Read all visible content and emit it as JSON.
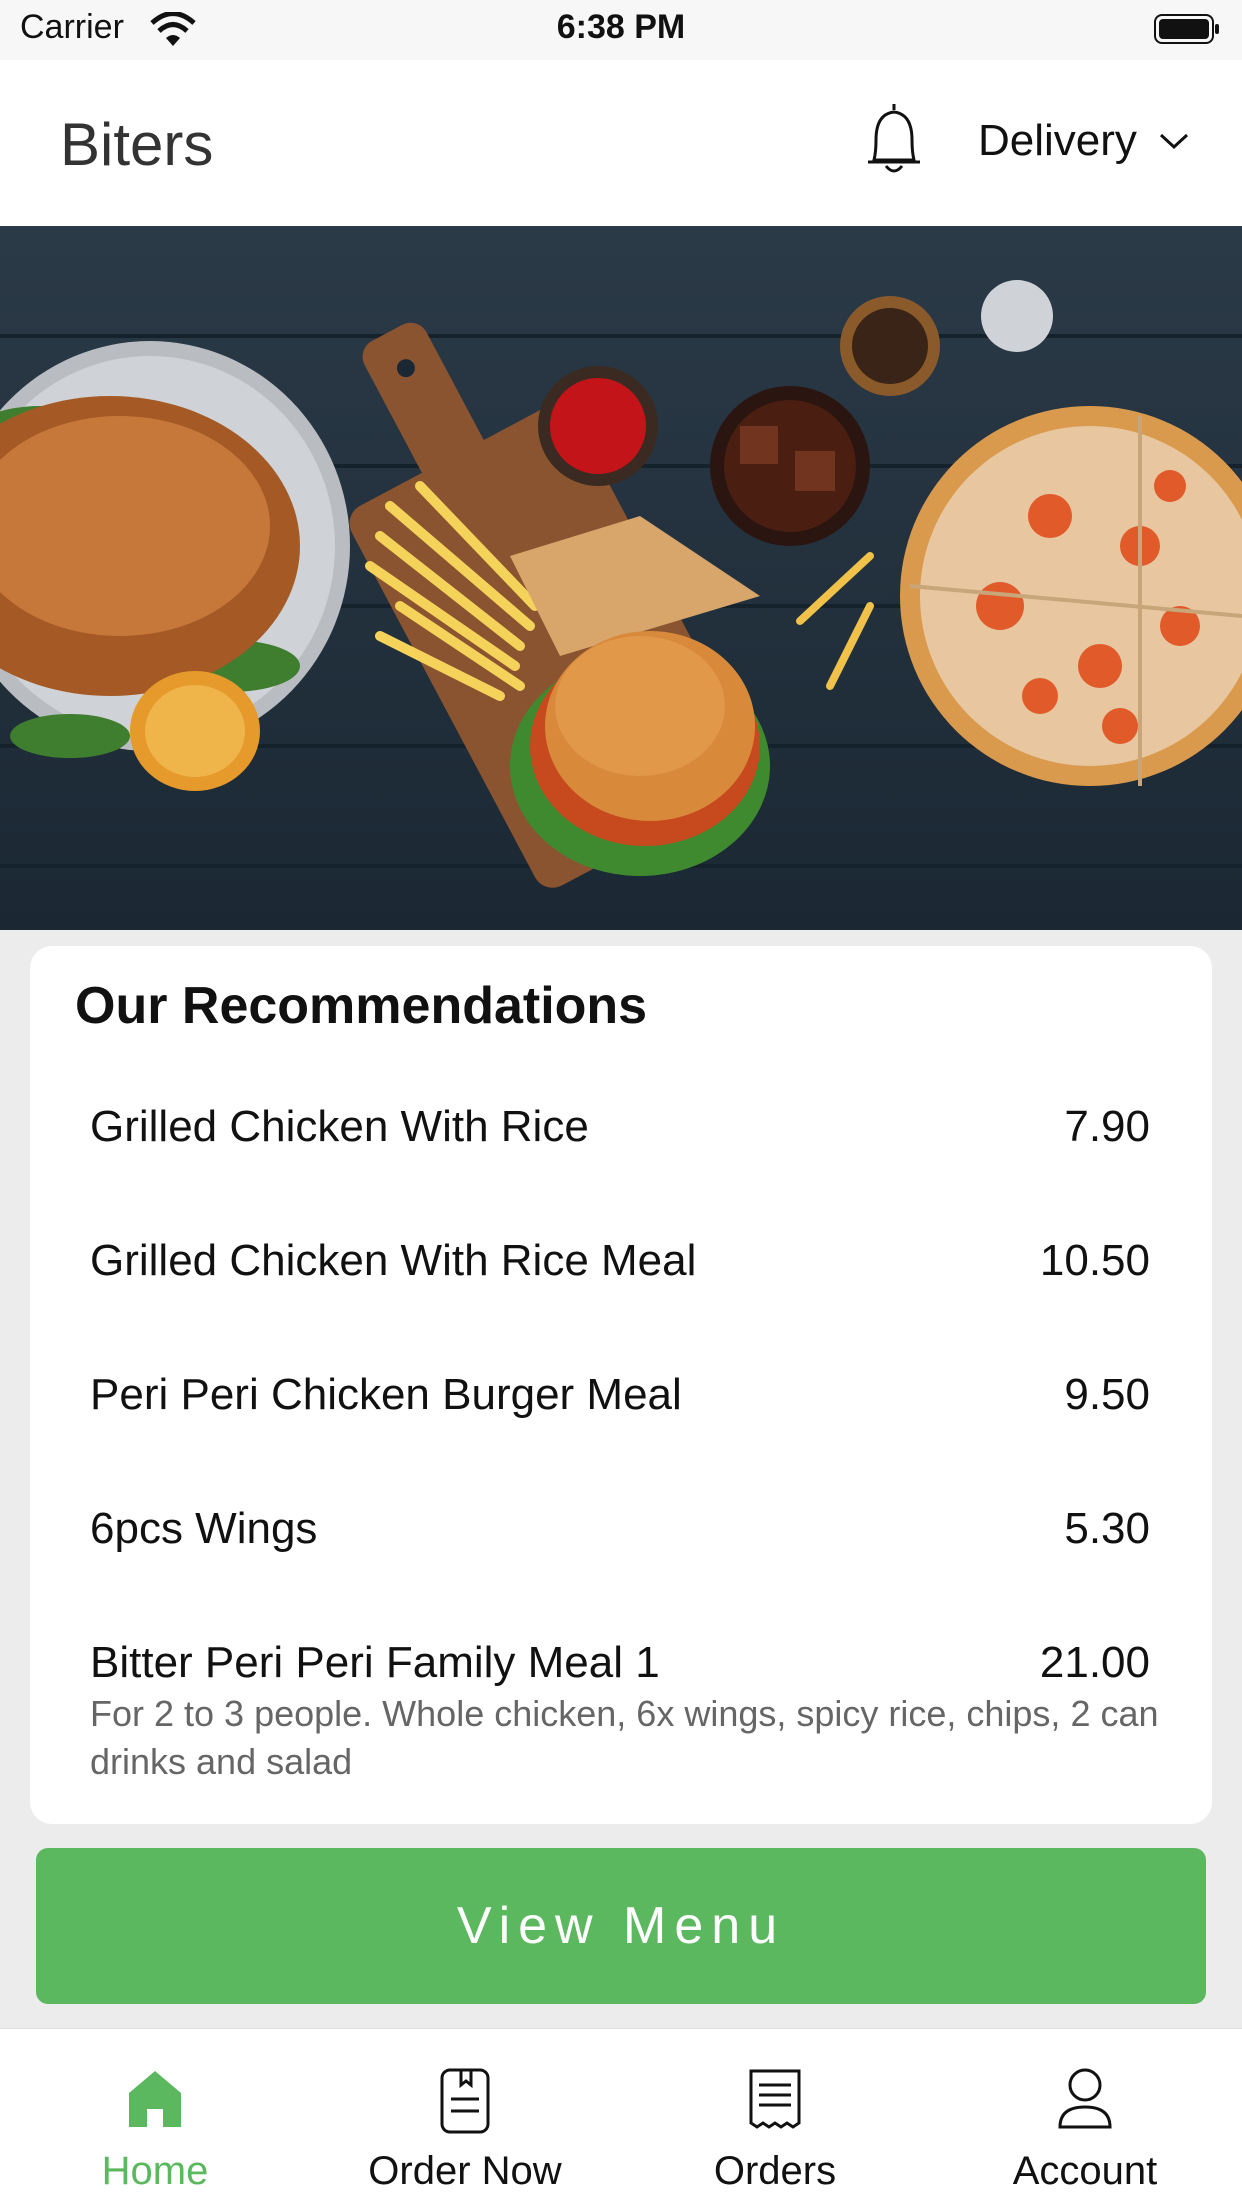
{
  "status_bar": {
    "carrier": "Carrier",
    "time": "6:38 PM"
  },
  "header": {
    "title": "Biters",
    "mode": "Delivery",
    "icons": [
      "bell-icon",
      "chevron-down-icon"
    ]
  },
  "recommendations": {
    "title": "Our Recommendations",
    "items": [
      {
        "name": "Grilled Chicken With Rice",
        "price": "7.90"
      },
      {
        "name": "Grilled Chicken With Rice Meal",
        "price": "10.50"
      },
      {
        "name": "Peri Peri Chicken Burger Meal",
        "price": "9.50"
      },
      {
        "name": "6pcs Wings",
        "price": "5.30"
      },
      {
        "name": "Bitter Peri Peri Family Meal 1",
        "price": "21.00",
        "description": "For 2 to 3 people. Whole chicken, 6x wings, spicy rice, chips, 2 can drinks and salad"
      }
    ]
  },
  "view_menu_label": "View Menu",
  "tabs": [
    {
      "label": "Home",
      "icon": "home-icon",
      "active": true
    },
    {
      "label": "Order Now",
      "icon": "menu-book-icon",
      "active": false
    },
    {
      "label": "Orders",
      "icon": "receipt-icon",
      "active": false
    },
    {
      "label": "Account",
      "icon": "user-icon",
      "active": false
    }
  ],
  "colors": {
    "accent": "#5cb85f",
    "background": "#ececec"
  }
}
